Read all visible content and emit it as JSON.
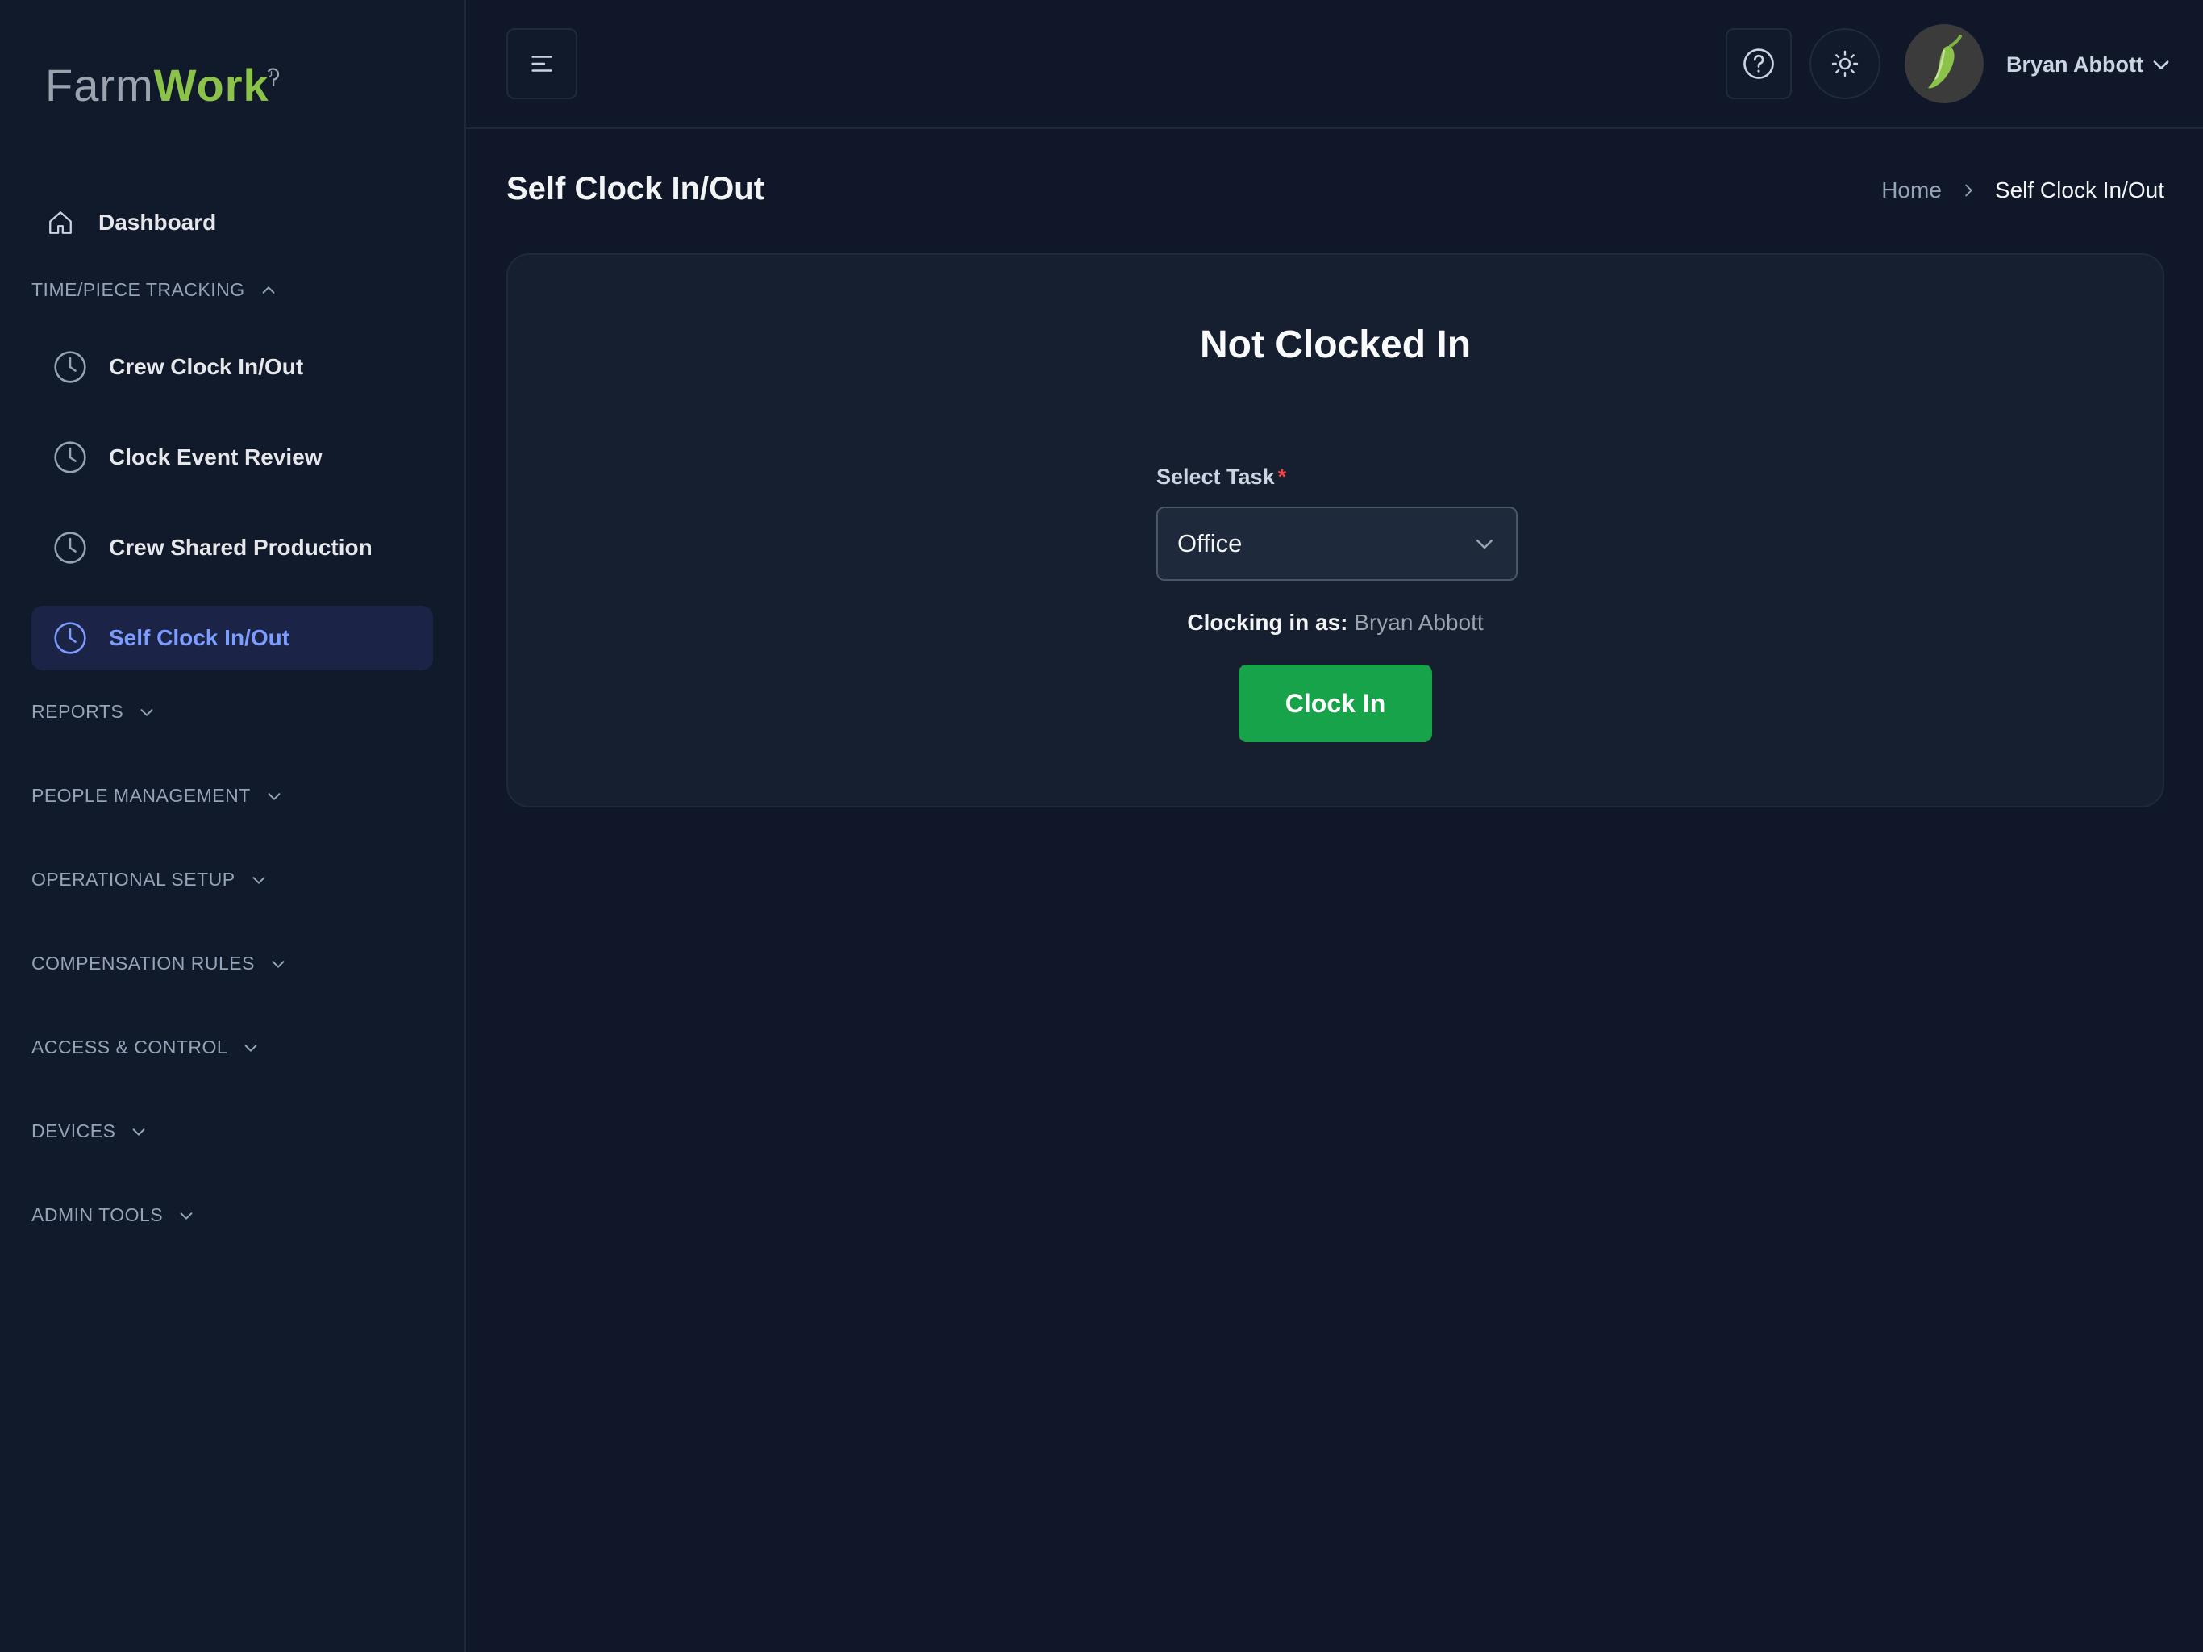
{
  "app": {
    "logo_farm": "Farm",
    "logo_work": "Work"
  },
  "sidebar": {
    "dashboard": {
      "label": "Dashboard",
      "icon": "home-icon"
    },
    "sections": [
      {
        "label": "TIME/PIECE TRACKING",
        "expanded": true
      },
      {
        "label": "REPORTS",
        "expanded": false
      },
      {
        "label": "PEOPLE MANAGEMENT",
        "expanded": false
      },
      {
        "label": "OPERATIONAL SETUP",
        "expanded": false
      },
      {
        "label": "COMPENSATION RULES",
        "expanded": false
      },
      {
        "label": "ACCESS & CONTROL",
        "expanded": false
      },
      {
        "label": "DEVICES",
        "expanded": false
      },
      {
        "label": "ADMIN TOOLS",
        "expanded": false
      }
    ],
    "tracking_items": [
      {
        "label": "Crew Clock In/Out",
        "icon": "clock-icon",
        "active": false
      },
      {
        "label": "Clock Event Review",
        "icon": "clock-icon",
        "active": false
      },
      {
        "label": "Crew Shared Production",
        "icon": "clock-icon",
        "active": false
      },
      {
        "label": "Self Clock In/Out",
        "icon": "clock-icon",
        "active": true
      }
    ]
  },
  "header": {
    "user_name": "Bryan Abbott",
    "icons": [
      "menu-icon",
      "help-icon",
      "sun-icon",
      "chevron-down-icon"
    ]
  },
  "page": {
    "title": "Self Clock In/Out",
    "breadcrumb": {
      "home": "Home",
      "current": "Self Clock In/Out"
    }
  },
  "card": {
    "status": "Not Clocked In",
    "task_label": "Select Task",
    "task_required_mark": "*",
    "task_value": "Office",
    "clocking_as_label": "Clocking in as:",
    "clocking_as_name": "Bryan Abbott",
    "clock_in_label": "Clock In"
  },
  "colors": {
    "background": "#0f1729",
    "sidebar": "#111a2b",
    "accent": "#7c9cff",
    "primary_button": "#16a34a",
    "brand_green": "#8bc34a",
    "required": "#ef4444"
  }
}
